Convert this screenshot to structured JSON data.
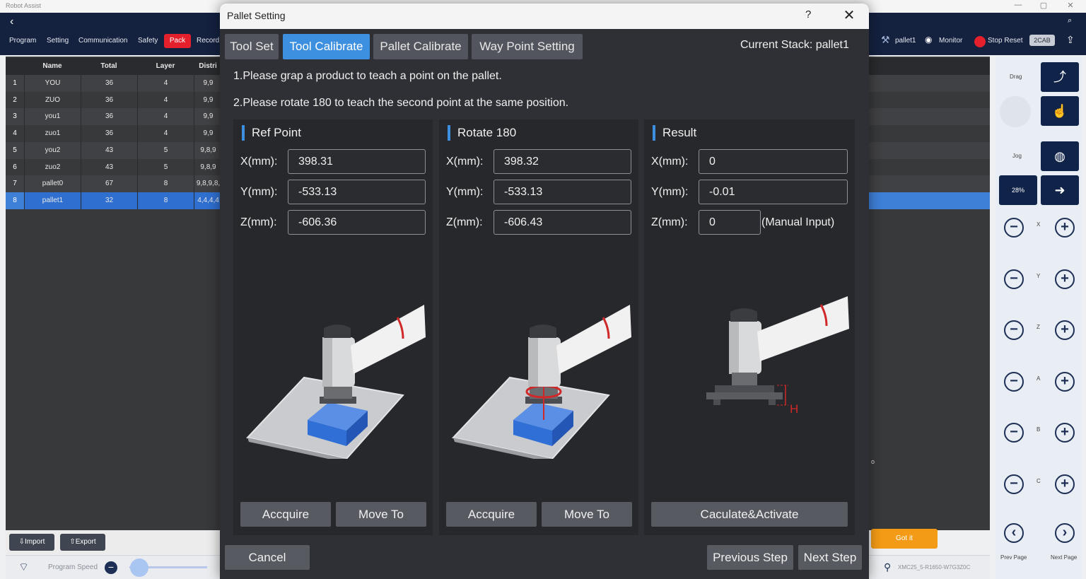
{
  "window": {
    "title": "Robot Assist",
    "controls": [
      "—",
      "▢",
      "✕"
    ]
  },
  "topbar": {
    "back": "‹",
    "menus": [
      "Program",
      "Setting",
      "Communication",
      "Safety",
      "Pack",
      "Record"
    ],
    "right": {
      "pallet": "pallet1",
      "monitor": "Monitor",
      "stop_reset": "Stop Reset",
      "badge": "2CAB"
    }
  },
  "table": {
    "headers": [
      "Name",
      "Total",
      "Layer",
      "Distri"
    ],
    "rows": [
      {
        "idx": "1",
        "name": "YOU",
        "total": "36",
        "layer": "4",
        "dist": "9,9"
      },
      {
        "idx": "2",
        "name": "ZUO",
        "total": "36",
        "layer": "4",
        "dist": "9,9"
      },
      {
        "idx": "3",
        "name": "you1",
        "total": "36",
        "layer": "4",
        "dist": "9,9"
      },
      {
        "idx": "4",
        "name": "zuo1",
        "total": "36",
        "layer": "4",
        "dist": "9,9"
      },
      {
        "idx": "5",
        "name": "you2",
        "total": "43",
        "layer": "5",
        "dist": "9,8,9"
      },
      {
        "idx": "6",
        "name": "zuo2",
        "total": "43",
        "layer": "5",
        "dist": "9,8,9"
      },
      {
        "idx": "7",
        "name": "pallet0",
        "total": "67",
        "layer": "8",
        "dist": "9,8,9,8,"
      },
      {
        "idx": "8",
        "name": "pallet1",
        "total": "32",
        "layer": "8",
        "dist": "4,4,4,4"
      }
    ],
    "selected_index": 7
  },
  "bottom": {
    "import": "Import",
    "export": "Export",
    "program_speed": "Program Speed",
    "got_it": "Got it",
    "device": "XMC25_5-R1650-W7G3Z0C",
    "marker": "o"
  },
  "rightpanel": {
    "drag": "Drag",
    "jog": "Jog",
    "speed": "28%",
    "axes": [
      "X",
      "Y",
      "Z",
      "A",
      "B",
      "C"
    ],
    "prev_page": "Prev Page",
    "next_page": "Next Page"
  },
  "dialog": {
    "title": "Pallet Setting",
    "help": "?",
    "close": "✕",
    "tabs": [
      "Tool Set",
      "Tool Calibrate",
      "Pallet Calibrate",
      "Way Point Setting"
    ],
    "active_tab": 1,
    "current_stack": "Current Stack: pallet1",
    "instruction1": "1.Please grap a product to teach a point on the pallet.",
    "instruction2": "2.Please rotate 180 to teach the second point at the same position.",
    "ref": {
      "title": "Ref Point",
      "x_label": "X(mm):",
      "y_label": "Y(mm):",
      "z_label": "Z(mm):",
      "x": "398.31",
      "y": "-533.13",
      "z": "-606.36",
      "acquire": "Accquire",
      "move_to": "Move To"
    },
    "rot": {
      "title": "Rotate 180",
      "x_label": "X(mm):",
      "y_label": "Y(mm):",
      "z_label": "Z(mm):",
      "x": "398.32",
      "y": "-533.13",
      "z": "-606.43",
      "acquire": "Accquire",
      "move_to": "Move To"
    },
    "result": {
      "title": "Result",
      "x_label": "X(mm):",
      "y_label": "Y(mm):",
      "z_label": "Z(mm):",
      "x": "0",
      "y": "-0.01",
      "z": "0",
      "manual": "(Manual Input)",
      "calc": "Caculate&Activate",
      "h_label": "H"
    },
    "cancel": "Cancel",
    "prev_step": "Previous Step",
    "next_step": "Next Step"
  },
  "colors": {
    "accent": "#3d8fe0",
    "dialog_bg": "#2f3035",
    "panel_bg": "#27282b",
    "topbar": "#14213f",
    "pack_red": "#e3202b",
    "got_it": "#f39b16",
    "box_blue": "#2f6fd6"
  }
}
